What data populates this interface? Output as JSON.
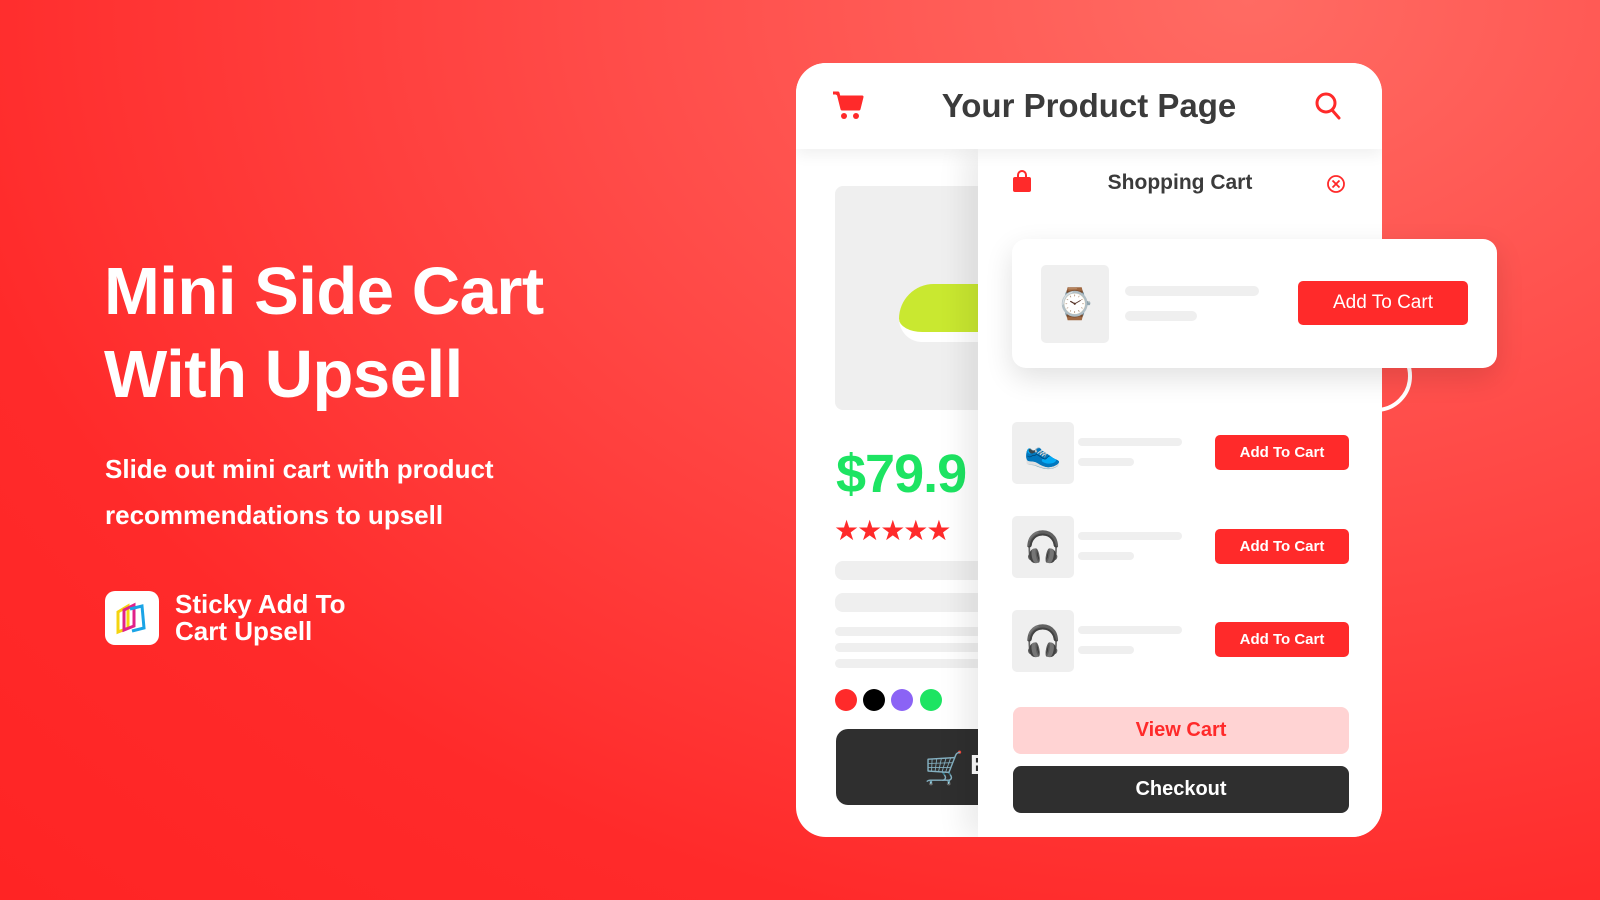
{
  "hero": {
    "title_line1": "Mini Side Cart",
    "title_line2": "With Upsell",
    "subtitle": "Slide out mini cart with product recommendations to upsell"
  },
  "brand": {
    "name_line1": "Sticky Add To",
    "name_line2": "Cart Upsell",
    "icon": "app-logo"
  },
  "product_page": {
    "title": "Your Product Page",
    "cart_icon": "cart-icon",
    "search_icon": "search-icon",
    "price": "$79.9",
    "rating": 5,
    "stars": "★★★★★",
    "price_color": "#1de462",
    "color_swatches": [
      "#ff2a2a",
      "#000000",
      "#8b63f5",
      "#1de462"
    ],
    "buy_button_partial": "B"
  },
  "cart": {
    "title": "Shopping Cart",
    "bag_icon": "shopping-bag-icon",
    "close_icon": "close-circle-icon",
    "featured": {
      "product": "smartwatch",
      "button": "Add To Cart"
    },
    "items": [
      {
        "product": "running-shoe",
        "button": "Add To Cart"
      },
      {
        "product": "black-headphones",
        "button": "Add To Cart"
      },
      {
        "product": "gold-headphones",
        "button": "Add To Cart"
      }
    ],
    "view_cart": "View Cart",
    "checkout": "Checkout"
  },
  "colors": {
    "accent": "#ff2a2a",
    "dark": "#2f2f2f",
    "view_cart_bg": "#ffd3d3"
  }
}
